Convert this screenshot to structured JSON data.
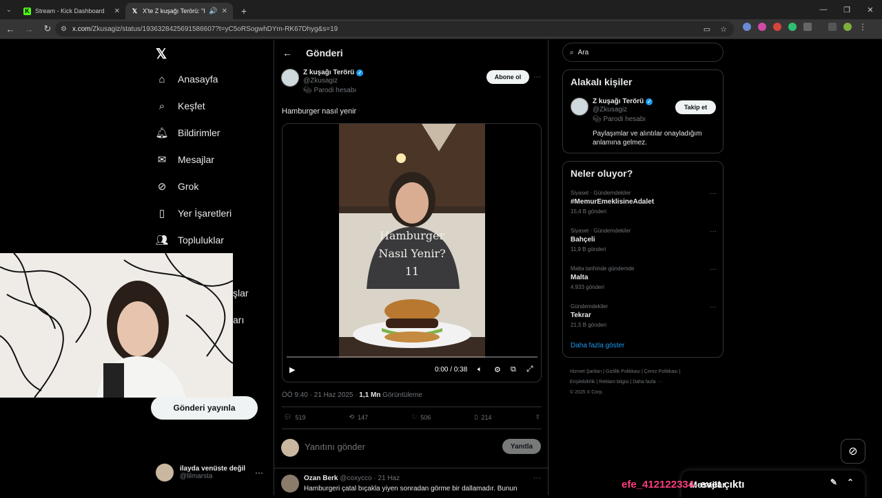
{
  "browser": {
    "tabs": [
      {
        "title": "Stream - Kick Dashboard",
        "favicon": "kick-icon"
      },
      {
        "title": "X'te Z kuşağı Terörü: \"Ham…",
        "favicon": "x-logo-icon"
      }
    ],
    "url_host": "x.com",
    "url_path": "/Zkusagiz/status/1936328425691586607?t=yC5oRSogwhDYm-RK67Dhyg&s=19"
  },
  "leftnav": {
    "items": [
      {
        "label": "Anasayfa",
        "icon": "home-icon"
      },
      {
        "label": "Keşfet",
        "icon": "search-icon"
      },
      {
        "label": "Bildirimler",
        "icon": "bell-icon"
      },
      {
        "label": "Mesajlar",
        "icon": "mail-icon"
      },
      {
        "label": "Grok",
        "icon": "grok-icon"
      },
      {
        "label": "Yer İşaretleri",
        "icon": "bookmark-icon"
      },
      {
        "label": "Topluluklar",
        "icon": "communities-icon"
      }
    ],
    "partial1": "şlar",
    "partial2": "arı",
    "post_button": "Gönderi yayınla",
    "account": {
      "name": "ilayda venüste değil",
      "handle": "@lilmarsta"
    }
  },
  "main": {
    "header_title": "Gönderi",
    "author": {
      "name": "Z kuşağı Terörü",
      "handle": "@Zkusagiz",
      "parody": "Parodi hesabı"
    },
    "subscribe_label": "Abone ol",
    "text": "Hamburger nasıl yenir",
    "video": {
      "caption_line1": "Hamburger",
      "caption_line2": "Nasıl Yenir?",
      "caption_line3": "11",
      "time": "0:00 / 0:38"
    },
    "meta": {
      "time": "ÖÖ 9:40 · 21 Haz 2025 · ",
      "views": "1,1 Mn",
      "views_label": " Görüntüleme"
    },
    "actions": {
      "replies": "519",
      "reposts": "147",
      "likes": "506",
      "bookmarks": "214"
    },
    "reply_placeholder": "Yanıtını gönder",
    "reply_button": "Yanıtla",
    "reply": {
      "name": "Ozan Berk",
      "handle": "@coxycco",
      "date": "21 Haz",
      "text": "Hamburgeri çatal bıçakla yiyen sonradan görme bir dallamadır. Bunun"
    }
  },
  "right": {
    "search_placeholder": "Ara",
    "related": {
      "title": "Alakalı kişiler",
      "name": "Z kuşağı Terörü",
      "handle": "@Zkusagiz",
      "parody": "Parodi hesabı",
      "bio": "Paylaşımlar ve alıntılar onayladığım anlamına gelmez.",
      "follow_label": "Takip et"
    },
    "trends": {
      "title": "Neler oluyor?",
      "items": [
        {
          "category": "Siyaset · Gündemdekiler",
          "title": "#MemurEmeklisineAdalet",
          "count": "15,4 B gönderi"
        },
        {
          "category": "Siyaset · Gündemdekiler",
          "title": "Bahçeli",
          "count": "11,9 B gönderi"
        },
        {
          "category": "Malta tarihinde gündemde",
          "title": "Malta",
          "count": "4.933 gönderi"
        },
        {
          "category": "Gündemdekiler",
          "title": "Tekrar",
          "count": "21,5 B gönderi"
        }
      ],
      "show_more": "Daha fazla göster"
    },
    "footer": {
      "l1": "Hizmet Şartları",
      "l2": "Gizlilik Politikası",
      "l3": "Çerez Politikası",
      "l4": "Erişilebilirlik",
      "l5": "Reklam bilgisi",
      "l6": "Daha fazla ···",
      "copyright": "© 2025 X Corp."
    }
  },
  "messages_dock": {
    "label": "Mesajlar"
  },
  "stream_overlay": {
    "user": "efe_412122334",
    "message": ": evet çıktı"
  },
  "colors": {
    "accent": "#1d9bf0",
    "overlay_user": "#ff3d7f"
  }
}
